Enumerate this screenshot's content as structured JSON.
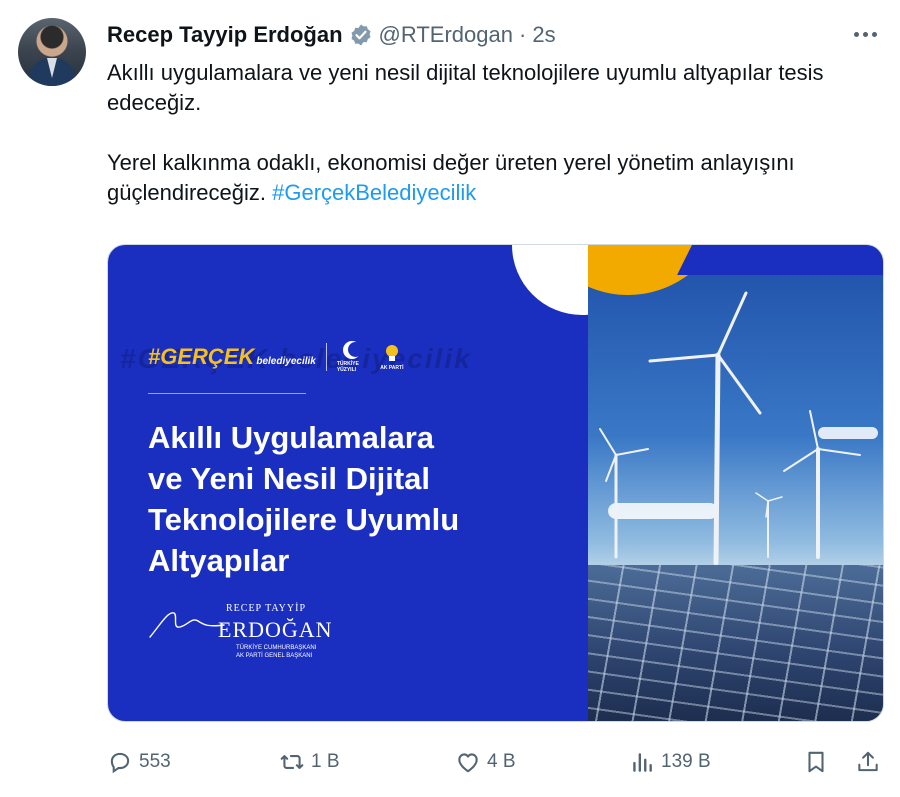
{
  "tweet": {
    "author_name": "Recep Tayyip Erdoğan",
    "handle": "@RTErdogan",
    "separator": "·",
    "time": "2s",
    "paragraph1": "Akıllı uygulamalara ve yeni nesil dijital teknolojilere uyumlu altyapılar tesis edeceğiz.",
    "paragraph2_text": "Yerel kalkınma odaklı, ekonomisi değer üreten yerel yönetim anlayışını güçlendireceğiz. ",
    "hashtag": "#GerçekBelediyecilik"
  },
  "media": {
    "ghost_text": "#GERÇEK belediyecilik",
    "campaign_tag": "#GERÇEK",
    "campaign_tag_suffix": "belediyecilik",
    "logo1_caption": "TÜRKİYE YÜZYILI",
    "logo2_caption": "AK PARTİ",
    "headline_lines": [
      "Akıllı Uygulamalara",
      "ve Yeni Nesil Dijital",
      "Teknolojilere Uyumlu"
    ],
    "headline_last": "Altyapılar",
    "signature_small": "RECEP TAYYİP",
    "signature_big": "ERDOĞAN",
    "signature_sub1": "TÜRKİYE CUMHURBAŞKANI",
    "signature_sub2": "AK PARTİ GENEL BAŞKANI",
    "colors": {
      "panel_blue": "#1a2ec0",
      "accent_yellow": "#f5c01c",
      "accent_red": "#e4202b"
    }
  },
  "actions": {
    "reply_count": "553",
    "retweet_count": "1 B",
    "like_count": "4 B",
    "views_count": "139 B"
  },
  "icons": [
    "verified-badge-icon",
    "more-icon",
    "reply-icon",
    "retweet-icon",
    "like-icon",
    "views-icon",
    "bookmark-icon",
    "share-icon"
  ],
  "colors": {
    "link": "#1d9bf0",
    "muted": "#536471",
    "text": "#0f1419"
  }
}
